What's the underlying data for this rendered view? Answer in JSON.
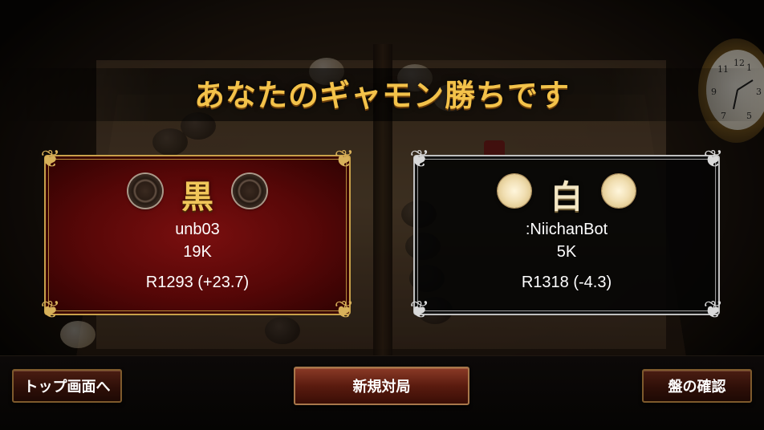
{
  "title": "あなたのギャモン勝ちです",
  "players": {
    "black": {
      "color_label": "黒",
      "name": "unb03",
      "rank": "19K",
      "rating": "R1293 (+23.7)",
      "panel_color": "#5e0808",
      "border_color": "#c8a14a"
    },
    "white": {
      "color_label": "白",
      "name": ":NiichanBot",
      "rank": "5K",
      "rating": "R1318 (-4.3)",
      "panel_color": "#050505",
      "border_color": "#bfbfbf"
    }
  },
  "buttons": {
    "top_screen": "トップ画面へ",
    "new_game": "新規対局",
    "check_board": "盤の確認"
  },
  "colors": {
    "title_gold": "#f3c24a",
    "button_bg": "#2f0f08",
    "button_border": "#7e5a2c"
  },
  "clock_numerals": [
    "12",
    "1",
    "11",
    "3",
    "9",
    "5",
    "7"
  ]
}
